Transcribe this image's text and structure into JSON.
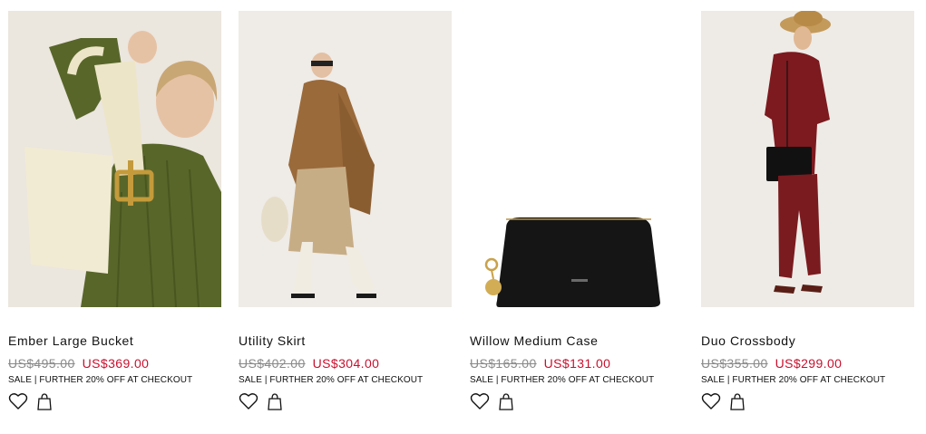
{
  "products": [
    {
      "name": "Ember Large Bucket",
      "old_price": "US$495.00",
      "new_price": "US$369.00",
      "promo": "SALE | FURTHER 20% OFF AT CHECKOUT"
    },
    {
      "name": "Utility Skirt",
      "old_price": "US$402.00",
      "new_price": "US$304.00",
      "promo": "SALE | FURTHER 20% OFF AT CHECKOUT"
    },
    {
      "name": "Willow Medium Case",
      "old_price": "US$165.00",
      "new_price": "US$131.00",
      "promo": "SALE | FURTHER 20% OFF AT CHECKOUT"
    },
    {
      "name": "Duo Crossbody",
      "old_price": "US$355.00",
      "new_price": "US$299.00",
      "promo": "SALE | FURTHER 20% OFF AT CHECKOUT"
    }
  ],
  "icons": {
    "wishlist": "heart-icon",
    "bag": "shopping-bag-icon"
  },
  "colors": {
    "sale_price": "#c8102e",
    "old_price": "#8a8a8a",
    "text": "#111111"
  }
}
